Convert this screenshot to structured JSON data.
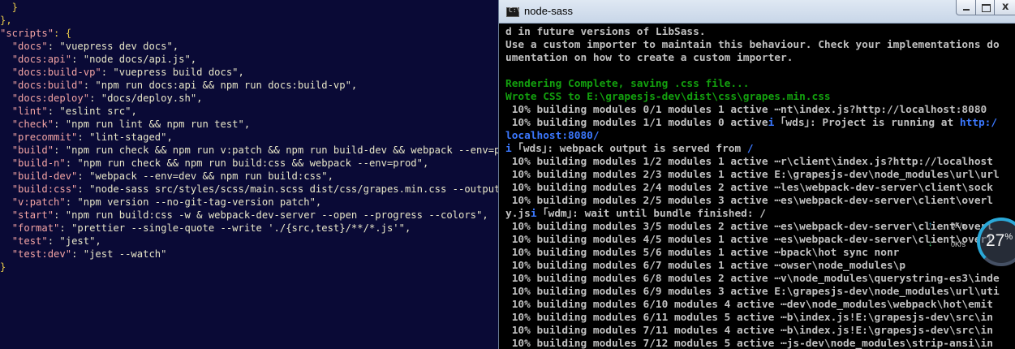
{
  "editor": {
    "lines": [
      [
        [
          "punc",
          "  }"
        ]
      ],
      [
        [
          "punc",
          "},"
        ]
      ],
      [
        [
          "scripts-key",
          "\"scripts\""
        ],
        [
          "punc",
          ": {"
        ]
      ],
      [
        [
          "str",
          "  "
        ],
        [
          "key",
          "\"docs\""
        ],
        [
          "str",
          ": \"vuepress dev docs\","
        ]
      ],
      [
        [
          "str",
          "  "
        ],
        [
          "key",
          "\"docs:api\""
        ],
        [
          "str",
          ": \"node docs/api.js\","
        ]
      ],
      [
        [
          "str",
          "  "
        ],
        [
          "key",
          "\"docs:build-vp\""
        ],
        [
          "str",
          ": \"vuepress build docs\","
        ]
      ],
      [
        [
          "str",
          "  "
        ],
        [
          "key",
          "\"docs:build\""
        ],
        [
          "str",
          ": \"npm run docs:api && npm run docs:build-vp\","
        ]
      ],
      [
        [
          "str",
          "  "
        ],
        [
          "key",
          "\"docs:deploy\""
        ],
        [
          "str",
          ": \"docs/deploy.sh\","
        ]
      ],
      [
        [
          "str",
          "  "
        ],
        [
          "key",
          "\"lint\""
        ],
        [
          "str",
          ": \"eslint src\","
        ]
      ],
      [
        [
          "str",
          "  "
        ],
        [
          "key",
          "\"check\""
        ],
        [
          "str",
          ": \"npm run lint && npm run test\","
        ]
      ],
      [
        [
          "str",
          "  "
        ],
        [
          "key",
          "\"precommit\""
        ],
        [
          "str",
          ": \"lint-staged\","
        ]
      ],
      [
        [
          "str",
          "  "
        ],
        [
          "key",
          "\"build\""
        ],
        [
          "str",
          ": \"npm run check && npm run v:patch && npm run build-dev && webpack --env=prod\""
        ]
      ],
      [
        [
          "str",
          "  "
        ],
        [
          "key",
          "\"build-n\""
        ],
        [
          "str",
          ": \"npm run check && npm run build:css && webpack --env=prod\","
        ]
      ],
      [
        [
          "str",
          "  "
        ],
        [
          "key",
          "\"build-dev\""
        ],
        [
          "str",
          ": \"webpack --env=dev && npm run build:css\","
        ]
      ],
      [
        [
          "str",
          "  "
        ],
        [
          "key",
          "\"build:css\""
        ],
        [
          "str",
          ": \"node-sass src/styles/scss/main.scss dist/css/grapes.min.css --output-sty"
        ]
      ],
      [
        [
          "str",
          "  "
        ],
        [
          "key",
          "\"v:patch\""
        ],
        [
          "str",
          ": \"npm version --no-git-tag-version patch\","
        ]
      ],
      [
        [
          "str",
          "  "
        ],
        [
          "key",
          "\"start\""
        ],
        [
          "str",
          ": \"npm run build:css -w & webpack-dev-server --open --progress --colors\","
        ]
      ],
      [
        [
          "str",
          "  "
        ],
        [
          "key",
          "\"format\""
        ],
        [
          "str",
          ": \"prettier --single-quote --write './{src,test}/**/*.js'\","
        ]
      ],
      [
        [
          "str",
          "  "
        ],
        [
          "key",
          "\"test\""
        ],
        [
          "str",
          ": \"jest\","
        ]
      ],
      [
        [
          "str",
          "  "
        ],
        [
          "key",
          "\"test:dev\""
        ],
        [
          "str",
          ": \"jest --watch\""
        ]
      ],
      [
        [
          "punc",
          "}"
        ]
      ]
    ]
  },
  "terminal": {
    "title": "node-sass",
    "icon": "cmd-icon",
    "close_label": "x",
    "lines": [
      [
        [
          "gray",
          "d in future versions of LibSass."
        ]
      ],
      [
        [
          "gray",
          "Use a custom importer to maintain this behaviour. Check your implementations do"
        ]
      ],
      [
        [
          "gray",
          "umentation on how to create a custom importer."
        ]
      ],
      [
        [
          "gray",
          ""
        ]
      ],
      [
        [
          "green",
          "Rendering Complete, saving .css file..."
        ]
      ],
      [
        [
          "green",
          "Wrote CSS to E:\\grapesjs-dev\\dist\\css\\grapes.min.css"
        ]
      ],
      [
        [
          "gray",
          " 10% building modules 0/1 modules 1 active ⋯nt\\index.js?http://localhost:8080"
        ]
      ],
      [
        [
          "gray",
          " 10% building modules 1/1 modules 0 active"
        ],
        [
          "blue",
          "i"
        ],
        [
          "gray",
          " "
        ],
        [
          "gray",
          "｢wds｣: Project is running at "
        ],
        [
          "blue",
          "http:/"
        ]
      ],
      [
        [
          "blue",
          "localhost:8080/"
        ]
      ],
      [
        [
          "blue",
          "i"
        ],
        [
          "gray",
          " "
        ],
        [
          "gray",
          "｢wds｣: webpack output is served from "
        ],
        [
          "blue",
          "/"
        ]
      ],
      [
        [
          "gray",
          " 10% building modules 1/2 modules 1 active ⋯r\\client\\index.js?http://localhost"
        ]
      ],
      [
        [
          "gray",
          " 10% building modules 2/3 modules 1 active E:\\grapesjs-dev\\node_modules\\url\\url"
        ]
      ],
      [
        [
          "gray",
          " 10% building modules 2/4 modules 2 active ⋯les\\webpack-dev-server\\client\\sock"
        ]
      ],
      [
        [
          "gray",
          " 10% building modules 2/5 modules 3 active ⋯es\\webpack-dev-server\\client\\overl"
        ]
      ],
      [
        [
          "gray",
          "y.js"
        ],
        [
          "blue",
          "i"
        ],
        [
          "gray",
          " ｢wdm｣: wait until bundle finished: /"
        ]
      ],
      [
        [
          "gray",
          " 10% building modules 3/5 modules 2 active ⋯es\\webpack-dev-server\\client\\overl"
        ]
      ],
      [
        [
          "gray",
          " 10% building modules 4/5 modules 1 active ⋯es\\webpack-dev-server\\client\\overl"
        ]
      ],
      [
        [
          "gray",
          " 10% building modules 5/6 modules 1 active ⋯bpack\\hot sync nonr"
        ]
      ],
      [
        [
          "gray",
          " 10% building modules 6/7 modules 1 active ⋯owser\\node_modules\\p"
        ]
      ],
      [
        [
          "gray",
          " 10% building modules 6/8 modules 2 active ⋯v\\node_modules\\querystring-es3\\inde"
        ]
      ],
      [
        [
          "gray",
          " 10% building modules 6/9 modules 3 active E:\\grapesjs-dev\\node_modules\\url\\uti"
        ]
      ],
      [
        [
          "gray",
          " 10% building modules 6/10 modules 4 active ⋯dev\\node_modules\\webpack\\hot\\emit"
        ]
      ],
      [
        [
          "gray",
          " 10% building modules 6/11 modules 5 active ⋯b\\index.js!E:\\grapesjs-dev\\src\\in"
        ]
      ],
      [
        [
          "gray",
          " 10% building modules 7/11 modules 4 active ⋯b\\index.js!E:\\grapesjs-dev\\src\\in"
        ]
      ],
      [
        [
          "gray",
          " 10% building modules 7/12 modules 5 active ⋯js-dev\\node_modules\\strip-ansi\\in"
        ]
      ]
    ]
  },
  "speed_widget": {
    "percent": "27",
    "percent_sign": "%",
    "up_rate": "0K/s",
    "down_rate": "0K/s",
    "up_arrow": "↑",
    "down_arrow": "↓",
    "accent_color": "#2aa8d8"
  }
}
